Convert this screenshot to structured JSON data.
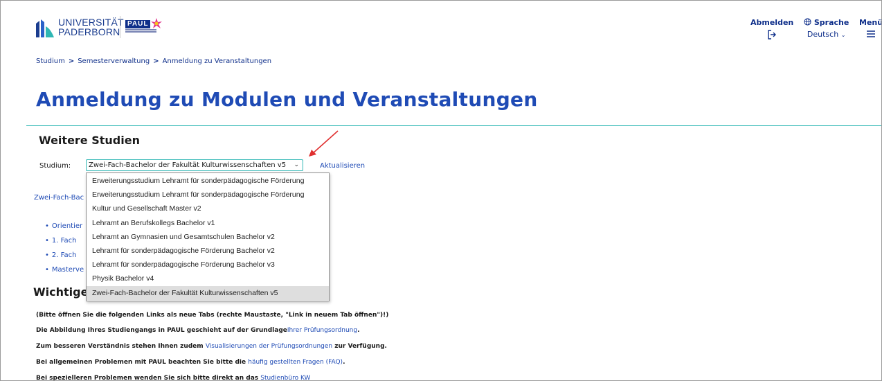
{
  "header": {
    "university_line1": "UNIVERSITÄT",
    "university_line2": "PADERBORN",
    "paul_label": "PAUL",
    "logout_label": "Abmelden",
    "language_label": "Sprache",
    "language_value": "Deutsch",
    "menu_label": "Menü"
  },
  "breadcrumb": {
    "items": [
      "Studium",
      "Semesterverwaltung",
      "Anmeldung zu Veranstaltungen"
    ],
    "separator": ">"
  },
  "page": {
    "title": "Anmeldung zu Modulen und Veranstaltungen",
    "section_title": "Weitere Studien",
    "studium_label": "Studium:",
    "selected_program": "Zwei-Fach-Bachelor der Fakultät Kulturwissenschaften v5",
    "refresh_label": "Aktualisieren",
    "program_link_partial": "Zwei-Fach-Bac",
    "list_partial": [
      "Orientier",
      "1. Fach",
      "2. Fach",
      "Masterve"
    ],
    "section2_partial": "Wichtige"
  },
  "dropdown": {
    "options": [
      "Erweiterungsstudium Lehramt für sonderpädagogische Förderung",
      "Erweiterungsstudium Lehramt für sonderpädagogische Förderung",
      "Kultur und Gesellschaft Master v2",
      "Lehramt an Berufskollegs Bachelor v1",
      "Lehramt an Gymnasien und Gesamtschulen Bachelor v2",
      "Lehramt für sonderpädagogische Förderung Bachelor v2",
      "Lehramt für sonderpädagogische Förderung Bachelor v3",
      "Physik Bachelor v4",
      "Zwei-Fach-Bachelor der Fakultät Kulturwissenschaften v5"
    ],
    "selected_index": 8
  },
  "info": {
    "line1": "(Bitte öffnen Sie die folgenden Links als neue Tabs (rechte Maustaste, \"Link in neuem Tab öffnen\")!)",
    "line2_pre": "Die Abbildung Ihres Studiengangs in PAUL geschieht auf der Grundlage",
    "line2_link": "Ihrer Prüfungsordnung",
    "line2_post": ".",
    "line3_pre": "Zum besseren Verständnis stehen Ihnen zudem ",
    "line3_link": "Visualisierungen der Prüfungsordnungen",
    "line3_post": " zur Verfügung.",
    "line4_pre": "Bei allgemeinen Problemen mit PAUL beachten Sie bitte die ",
    "line4_link": "häufig gestellten Fragen (FAQ)",
    "line4_post": ".",
    "line5_pre": "Bei spezielleren Problemen wenden Sie sich bitte direkt an das ",
    "line5_link": "Studienbüro KW"
  },
  "colors": {
    "brand_blue": "#1f4bb5",
    "dark_blue": "#0f2f8a",
    "teal_accent": "#2fb7b4",
    "annotation_red": "#e03030"
  }
}
